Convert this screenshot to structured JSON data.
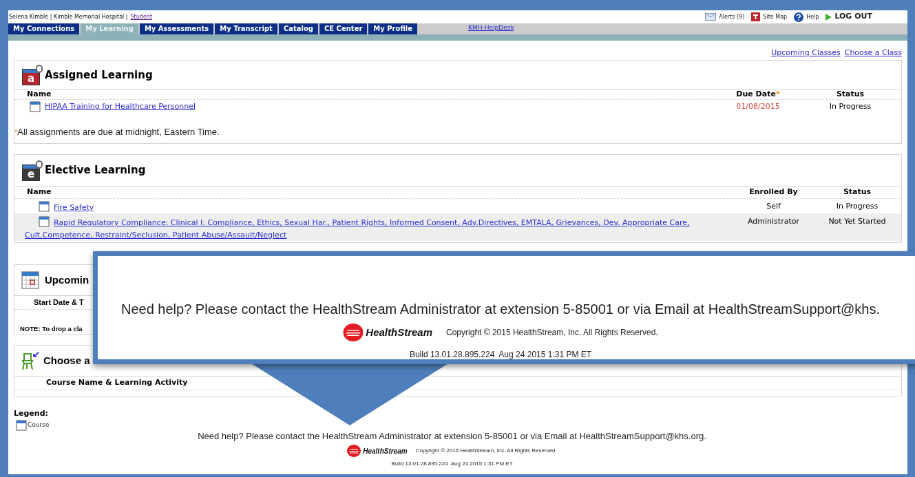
{
  "header": {
    "user": "Selena Kimble | Kimble Memorial Hospital |",
    "role_link": "Student",
    "utility_links": [
      {
        "kind": "alerts",
        "label": "Alerts (9)"
      },
      {
        "kind": "sitemap",
        "label": "Site Map"
      },
      {
        "kind": "help",
        "label": "Help"
      },
      {
        "kind": "logout",
        "label": "LOG OUT"
      }
    ]
  },
  "tabs": [
    {
      "label": "My Connections",
      "selected": false
    },
    {
      "label": "My Learning",
      "selected": true
    },
    {
      "label": "My Assessments",
      "selected": false
    },
    {
      "label": "My Transcript",
      "selected": false
    },
    {
      "label": "Catalog",
      "selected": false
    },
    {
      "label": "CE Center",
      "selected": false
    },
    {
      "label": "My Profile",
      "selected": false
    }
  ],
  "helpdesk_link": "KMH-HelpDesk",
  "quick_links": [
    "Upcoming Classes",
    "Choose a Class"
  ],
  "assigned": {
    "title": "Assigned Learning",
    "icon_letter": "a",
    "columns": [
      "Name",
      "Due Date",
      "Status"
    ],
    "required_mark": "*",
    "rows": [
      {
        "name": "HIPAA Training for Healthcare Personnel",
        "due_date": "01/08/2015",
        "status": "In Progress"
      }
    ],
    "note": "All assignments are due at midnight, Eastern Time."
  },
  "elective": {
    "title": "Elective Learning",
    "icon_letter": "e",
    "columns": [
      "Name",
      "Enrolled By",
      "Status"
    ],
    "rows": [
      {
        "name": "Fire Safety",
        "enrolled_by": "Self",
        "status": "In Progress"
      },
      {
        "name": "Rapid Regulatory Compliance: Clinical I: Compliance, Ethics, Sexual Har., Patient Rights, Informed Consent, Adv.Directives, EMTALA, Grievances, Dev. Appropriate Care, Cult.Competence, Restraint/Seclusion, Patient Abuse/Assault/Neglect",
        "enrolled_by": "Administrator",
        "status": "Not Yet Started"
      }
    ]
  },
  "upcoming": {
    "title": "Upcomin",
    "column": "Start Date & T",
    "note": "NOTE: To drop a cla"
  },
  "choose": {
    "title": "Choose a",
    "column": "Course Name & Learning Activity"
  },
  "legend": {
    "title": "Legend:",
    "items": [
      "Course"
    ]
  },
  "footer": {
    "help": "Need help? Please contact the HealthStream Administrator at extension 5-85001 or via Email at HealthStreamSupport@khs.org.",
    "logo": "HealthStream",
    "copyright": "Copyright © 2015 HealthStream, Inc. All Rights Reserved.",
    "build": "Build 13.01.28.895.224  Aug 24 2015 1:31 PM ET"
  },
  "callout": {
    "help": "Need help? Please contact the HealthStream Administrator at extension 5-85001 or via Email at HealthStreamSupport@khs.",
    "logo": "HealthStream",
    "copyright": "Copyright © 2015 HealthStream, Inc. All Rights Reserved.",
    "build": "Build 13.01.28.895.224  Aug 24 2015 1:31 PM ET"
  }
}
